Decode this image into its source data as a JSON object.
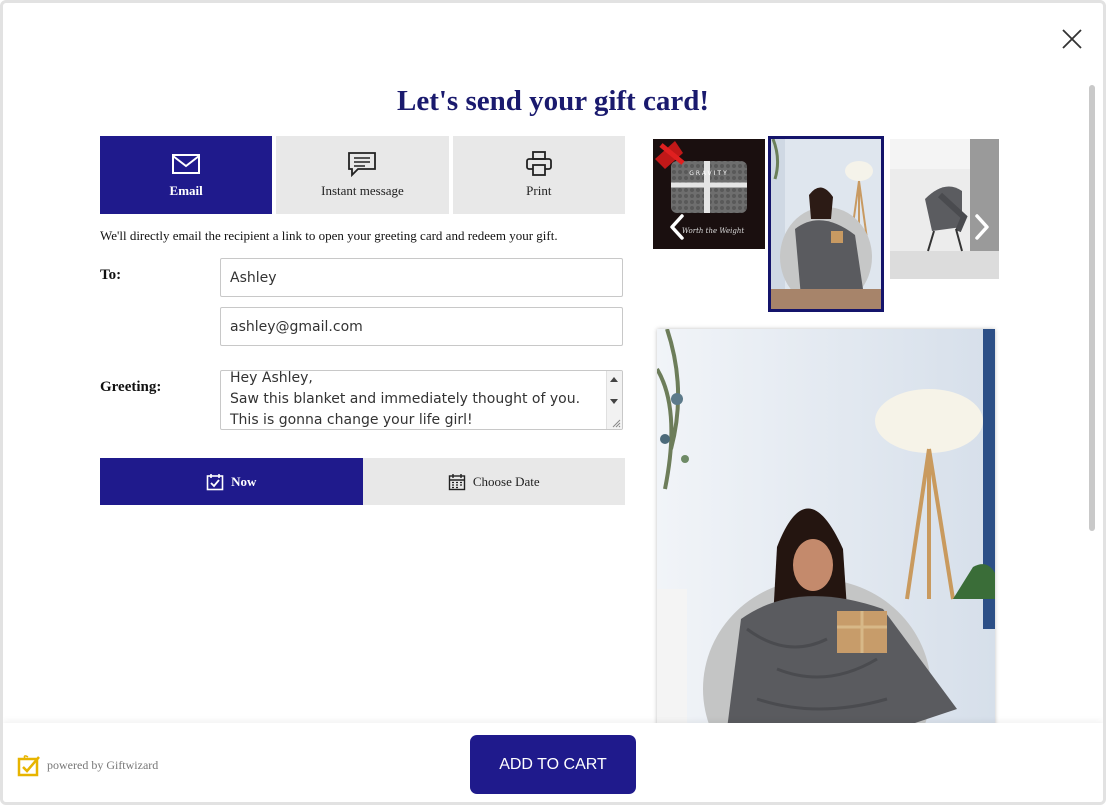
{
  "dialog": {
    "title": "Let's send your gift card!"
  },
  "tabs": [
    {
      "label": "Email",
      "icon": "envelope-icon",
      "active": true
    },
    {
      "label": "Instant message",
      "icon": "message-icon",
      "active": false
    },
    {
      "label": "Print",
      "icon": "printer-icon",
      "active": false
    }
  ],
  "form": {
    "description": "We'll directly email the recipient a link to open your greeting card and redeem your gift.",
    "to_label": "To:",
    "name_value": "Ashley",
    "email_value": "ashley@gmail.com",
    "greeting_label": "Greeting:",
    "greeting_value": "Hey Ashley,\nSaw this blanket and immediately thought of you.\nThis is gonna change your life girl!"
  },
  "delivery": {
    "now_label": "Now",
    "choose_date_label": "Choose Date",
    "selected": "now"
  },
  "gallery": {
    "thumbnails": [
      {
        "name": "gravity-product-thumbnail",
        "caption_brand": "GRAVITY",
        "caption_tagline": "Worth the Weight"
      },
      {
        "name": "woman-blanket-thumbnail",
        "selected": true
      },
      {
        "name": "chair-blanket-thumbnail"
      }
    ]
  },
  "footer": {
    "powered_by": "powered by Giftwizard",
    "add_to_cart": "ADD TO CART"
  },
  "colors": {
    "primary": "#1f1a8c",
    "title": "#1a1a6e",
    "tab_inactive": "#e8e8e8"
  }
}
